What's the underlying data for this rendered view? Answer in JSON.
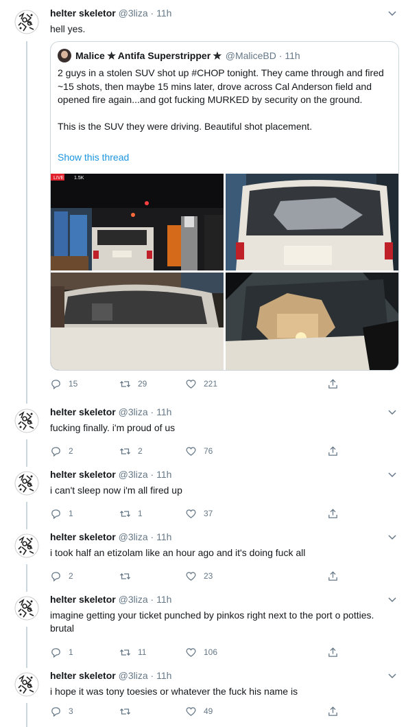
{
  "author": {
    "name": "helter skeletor",
    "handle": "@3liza",
    "time": "11h",
    "separator": "·"
  },
  "colors": {
    "text": "#14171a",
    "secondary": "#657786",
    "link": "#1b95e0",
    "border": "#e6ecf0",
    "thread_line": "#ccd6dd"
  },
  "icons": {
    "reply": "reply-icon",
    "retweet": "retweet-icon",
    "like": "heart-icon",
    "share": "share-icon",
    "menu": "chevron-down-icon"
  },
  "quote": {
    "name": "Malice ✯ Antifa Superstripper ✯",
    "handle": "@MaliceBD",
    "time": "11h",
    "text": "2 guys in a stolen SUV shot up #CHOP tonight. They came through and fired ~15 shots, then maybe 15 mins later, drove across Cal Anderson field and opened fire again...and got fucking MURKED by security on the ground.\n\nThis is the SUV they were driving. Beautiful shot placement.",
    "show_thread": "Show this thread",
    "overlay_badge": "LIVE",
    "overlay_views": "1.5K"
  },
  "tweets": [
    {
      "text": "hell yes.",
      "replies": "15",
      "retweets": "29",
      "likes": "221"
    },
    {
      "text": "fucking finally. i'm proud of us",
      "replies": "2",
      "retweets": "2",
      "likes": "76"
    },
    {
      "text": "i can't sleep now i'm all fired up",
      "replies": "1",
      "retweets": "1",
      "likes": "37"
    },
    {
      "text": "i took half an etizolam like an hour ago and it's doing fuck all",
      "replies": "2",
      "retweets": "",
      "likes": "23"
    },
    {
      "text": "imagine getting your ticket punched by pinkos right next to the port o potties. brutal",
      "replies": "1",
      "retweets": "11",
      "likes": "106"
    },
    {
      "text": "i hope it was tony toesies or whatever the fuck his name is",
      "replies": "3",
      "retweets": "",
      "likes": "49"
    }
  ]
}
